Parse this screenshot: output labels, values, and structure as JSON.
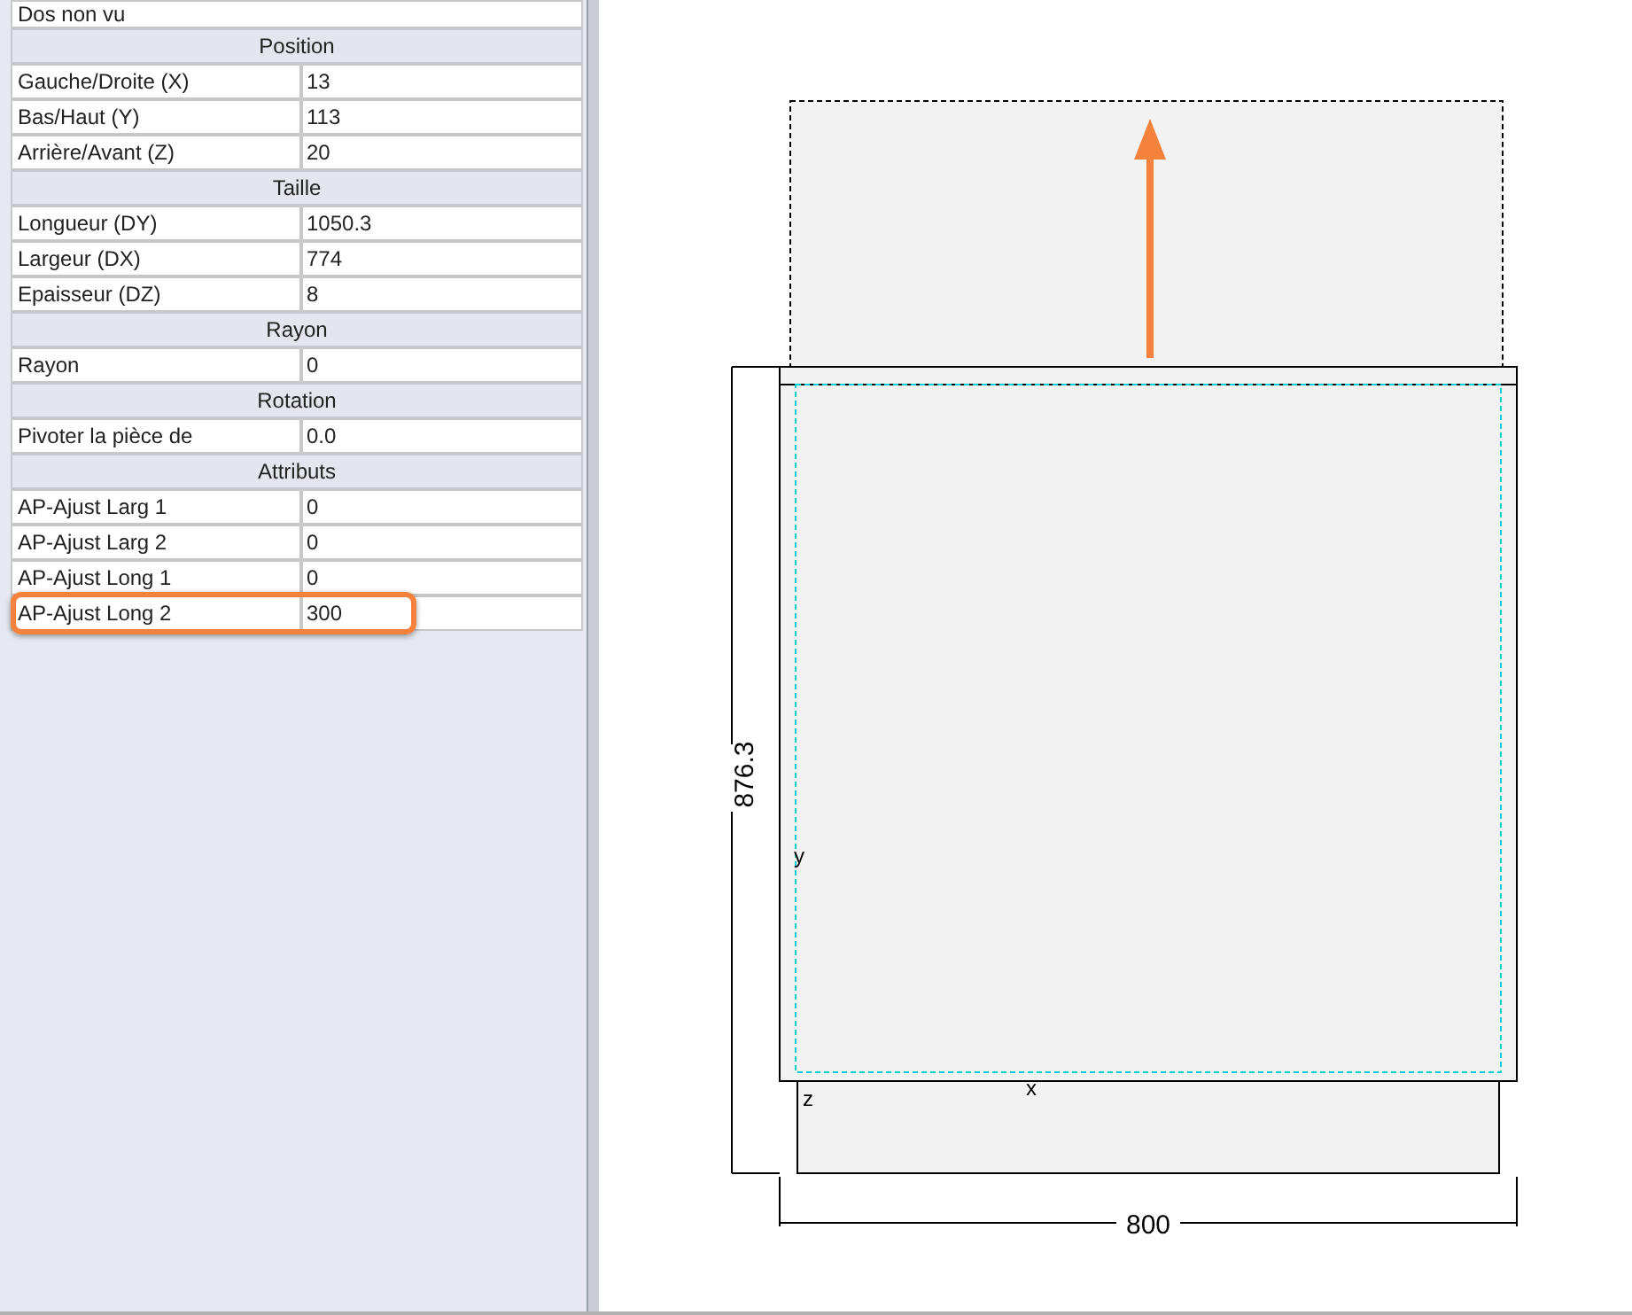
{
  "top_row": {
    "label": "Dos non vu"
  },
  "sections": [
    {
      "title": "Position",
      "rows": [
        {
          "label": "Gauche/Droite (X)",
          "value": "13",
          "highlighted": false
        },
        {
          "label": "Bas/Haut (Y)",
          "value": "113",
          "highlighted": false
        },
        {
          "label": "Arrière/Avant (Z)",
          "value": "20",
          "highlighted": false
        }
      ]
    },
    {
      "title": "Taille",
      "rows": [
        {
          "label": "Longueur (DY)",
          "value": "1050.3",
          "highlighted": false
        },
        {
          "label": "Largeur (DX)",
          "value": "774",
          "highlighted": false
        },
        {
          "label": "Epaisseur (DZ)",
          "value": "8",
          "highlighted": false
        }
      ]
    },
    {
      "title": "Rayon",
      "rows": [
        {
          "label": "Rayon",
          "value": "0",
          "highlighted": false
        }
      ]
    },
    {
      "title": "Rotation",
      "rows": [
        {
          "label": "Pivoter la pièce de",
          "value": "0.0",
          "highlighted": false
        }
      ]
    },
    {
      "title": "Attributs",
      "rows": [
        {
          "label": "AP-Ajust Larg 1",
          "value": "0",
          "highlighted": false
        },
        {
          "label": "AP-Ajust Larg 2",
          "value": "0",
          "highlighted": false
        },
        {
          "label": "AP-Ajust Long 1",
          "value": "0",
          "highlighted": false
        },
        {
          "label": "AP-Ajust Long 2",
          "value": "300",
          "highlighted": true
        }
      ]
    }
  ],
  "drawing": {
    "height_dimension": "876.3",
    "width_dimension": "800",
    "axis_x": "x",
    "axis_y": "y",
    "axis_z": "z"
  }
}
